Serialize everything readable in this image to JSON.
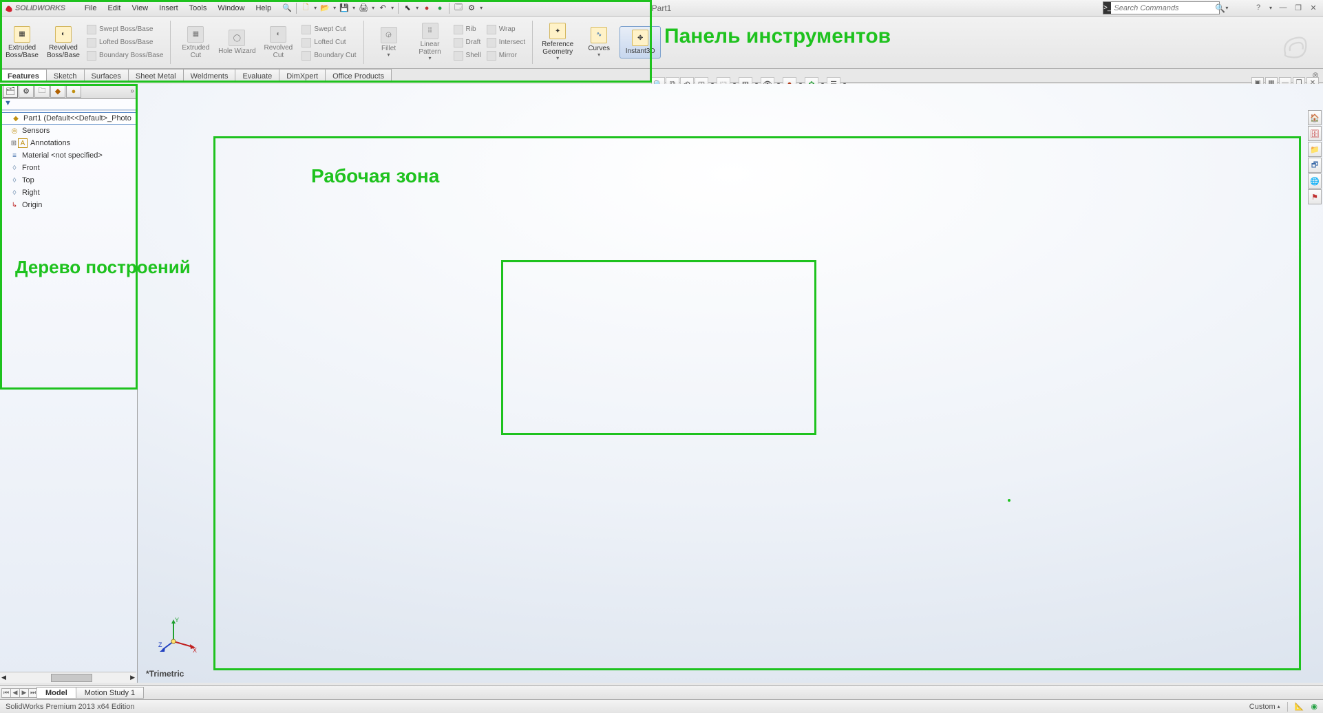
{
  "app": {
    "logo_text": "SOLIDWORKS",
    "doc_title": "Part1"
  },
  "menus": [
    "File",
    "Edit",
    "View",
    "Insert",
    "Tools",
    "Window",
    "Help"
  ],
  "search": {
    "placeholder": "Search Commands"
  },
  "window_controls": {
    "help": "?",
    "min": "—",
    "restore": "❐",
    "close": "✕"
  },
  "ribbon": {
    "extruded_boss": "Extruded Boss/Base",
    "revolved_boss": "Revolved Boss/Base",
    "swept_boss": "Swept Boss/Base",
    "lofted_boss": "Lofted Boss/Base",
    "boundary_boss": "Boundary Boss/Base",
    "extruded_cut": "Extruded Cut",
    "hole_wizard": "Hole Wizard",
    "revolved_cut": "Revolved Cut",
    "swept_cut": "Swept Cut",
    "lofted_cut": "Lofted Cut",
    "boundary_cut": "Boundary Cut",
    "fillet": "Fillet",
    "linear_pattern": "Linear Pattern",
    "rib": "Rib",
    "draft": "Draft",
    "shell": "Shell",
    "wrap": "Wrap",
    "intersect": "Intersect",
    "mirror": "Mirror",
    "ref_geometry": "Reference Geometry",
    "curves": "Curves",
    "instant3d": "Instant3D"
  },
  "ribtabs": [
    "Features",
    "Sketch",
    "Surfaces",
    "Sheet Metal",
    "Weldments",
    "Evaluate",
    "DimXpert",
    "Office Products"
  ],
  "tree": {
    "root": "Part1  (Default<<Default>_Photo",
    "items": [
      "Sensors",
      "Annotations",
      "Material <not specified>",
      "Front",
      "Top",
      "Right",
      "Origin"
    ]
  },
  "annotations": {
    "toolbar_label": "Панель инструментов",
    "tree_label": "Дерево построений",
    "workarea_label": "Рабочая зона"
  },
  "view_name": "*Trimetric",
  "bottom_tabs": {
    "model": "Model",
    "motion": "Motion Study 1"
  },
  "status": {
    "edition": "SolidWorks Premium 2013 x64 Edition",
    "custom": "Custom"
  }
}
